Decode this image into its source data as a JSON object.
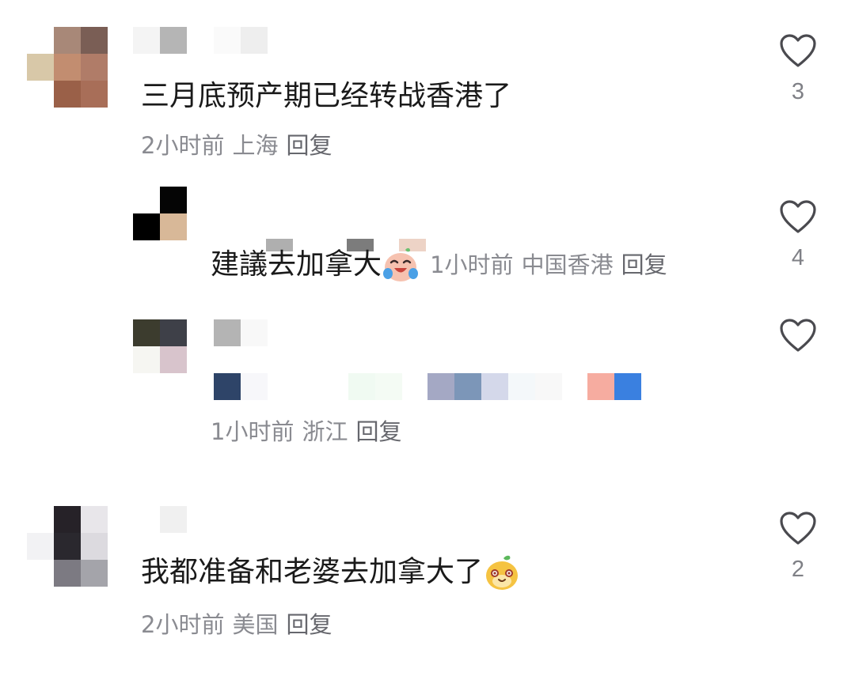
{
  "comments": [
    {
      "text": "三月底预产期已经转战香港了",
      "time": "2小时前",
      "location": "上海",
      "reply_label": "回复",
      "likes": "3"
    },
    {
      "text": "建議去加拿大",
      "time": "1小时前",
      "location": "中国香港",
      "reply_label": "回复",
      "likes": "4",
      "emoji_icon": "crying-laughing-face-emoji"
    },
    {
      "text": "",
      "time": "1小时前",
      "location": "浙江",
      "reply_label": "回复",
      "likes": ""
    },
    {
      "text": "我都准备和老婆去加拿大了",
      "time": "2小时前",
      "location": "美国",
      "reply_label": "回复",
      "likes": "2",
      "emoji_icon": "happy-mango-face-emoji"
    }
  ],
  "icons": {
    "like": "heart-outline-icon"
  },
  "colors": {
    "text": "#1a1a1a",
    "meta": "#8a8b91",
    "heart": "#4a4a4f"
  }
}
